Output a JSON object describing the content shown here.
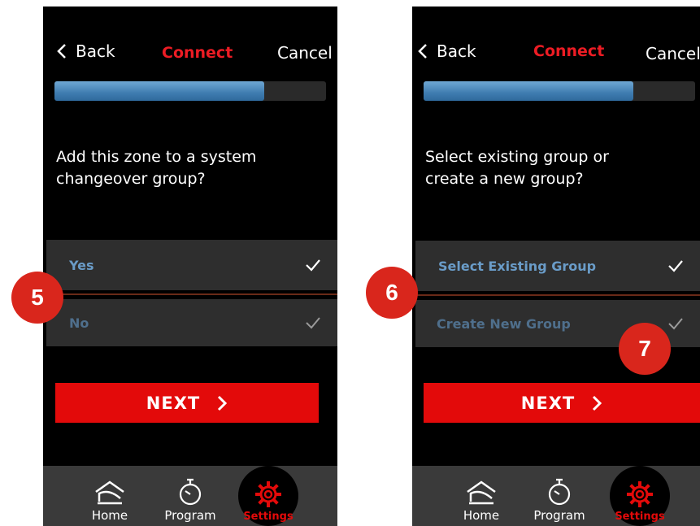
{
  "screens": [
    {
      "back_label": "Back",
      "title": "Connect",
      "cancel_label": "Cancel",
      "progress": 0.8,
      "question": [
        "Add this zone to a system",
        "changeover group?"
      ],
      "options": [
        {
          "label": "Yes",
          "selected": true
        },
        {
          "label": "No",
          "selected": false
        }
      ],
      "next_label": "NEXT",
      "nav": {
        "home": "Home",
        "program": "Program",
        "settings": "Settings"
      }
    },
    {
      "back_label": "Back",
      "title": "Connect",
      "cancel_label": "Cancel",
      "progress": 0.8,
      "question": [
        "Select existing group or",
        "create a new group?"
      ],
      "options": [
        {
          "label": "Select Existing Group",
          "selected": true
        },
        {
          "label": "Create New Group",
          "selected": false
        }
      ],
      "next_label": "NEXT",
      "nav": {
        "home": "Home",
        "program": "Program",
        "settings": "Settings"
      }
    }
  ],
  "callouts": [
    "5",
    "6",
    "7"
  ],
  "colors": {
    "accent_red": "#e30a0a",
    "title_red": "#ec1c24",
    "option_text_selected": "#6a9cc8",
    "option_text_unselected": "#4f6f8c"
  }
}
